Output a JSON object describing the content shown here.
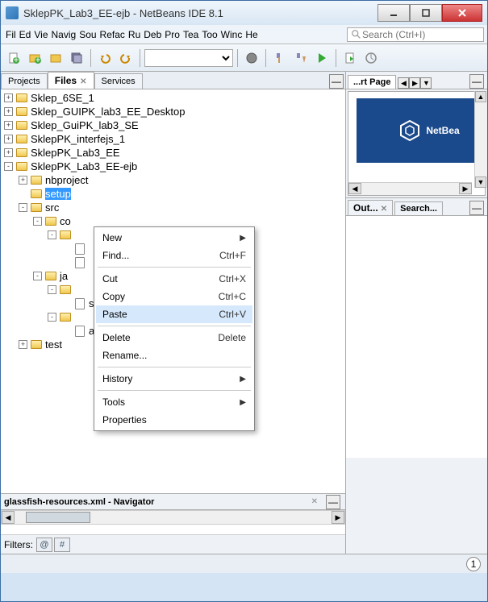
{
  "title": "SklepPK_Lab3_EE-ejb - NetBeans IDE 8.1",
  "menus": [
    "Fil",
    "Ed",
    "Vie",
    "Navig",
    "Sou",
    "Refac",
    "Ru",
    "Deb",
    "Pro",
    "Tea",
    "Too",
    "Winc",
    "He"
  ],
  "search_placeholder": "Search (Ctrl+I)",
  "tabs": {
    "projects": "Projects",
    "files": "Files",
    "services": "Services"
  },
  "tree": [
    {
      "indent": 0,
      "toggle": "+",
      "icon": "folder",
      "label": "Sklep_6SE_1"
    },
    {
      "indent": 0,
      "toggle": "+",
      "icon": "folder",
      "label": "Sklep_GUIPK_lab3_EE_Desktop"
    },
    {
      "indent": 0,
      "toggle": "+",
      "icon": "folder",
      "label": "Sklep_GuiPK_lab3_SE"
    },
    {
      "indent": 0,
      "toggle": "+",
      "icon": "folder",
      "label": "SklepPK_interfejs_1"
    },
    {
      "indent": 0,
      "toggle": "+",
      "icon": "folder",
      "label": "SklepPK_Lab3_EE"
    },
    {
      "indent": 0,
      "toggle": "-",
      "icon": "folder",
      "label": "SklepPK_Lab3_EE-ejb"
    },
    {
      "indent": 1,
      "toggle": "+",
      "icon": "folder",
      "label": "nbproject"
    },
    {
      "indent": 1,
      "toggle": "",
      "icon": "folder",
      "label": "setup",
      "selected": true
    },
    {
      "indent": 1,
      "toggle": "-",
      "icon": "folder",
      "label": "src"
    },
    {
      "indent": 2,
      "toggle": "-",
      "icon": "folder",
      "label": "co"
    },
    {
      "indent": 3,
      "toggle": "-",
      "icon": "folder",
      "label": ""
    },
    {
      "indent": 4,
      "toggle": "",
      "icon": "file",
      "label": ""
    },
    {
      "indent": 4,
      "toggle": "",
      "icon": "file",
      "label": ""
    },
    {
      "indent": 2,
      "toggle": "-",
      "icon": "folder",
      "label": "ja"
    },
    {
      "indent": 3,
      "toggle": "-",
      "icon": "folder",
      "label": ""
    },
    {
      "indent": 4,
      "toggle": "",
      "icon": "file",
      "label": "sowej_ejb.java"
    },
    {
      "indent": 3,
      "toggle": "-",
      "icon": "folder",
      "label": ""
    },
    {
      "indent": 4,
      "toggle": "",
      "icon": "file",
      "label": "ava"
    },
    {
      "indent": 1,
      "toggle": "+",
      "icon": "folder",
      "label": "test"
    }
  ],
  "context_menu": [
    {
      "label": "New",
      "shortcut": "",
      "arrow": true
    },
    {
      "label": "Find...",
      "shortcut": "Ctrl+F"
    },
    {
      "sep": true
    },
    {
      "label": "Cut",
      "shortcut": "Ctrl+X"
    },
    {
      "label": "Copy",
      "shortcut": "Ctrl+C"
    },
    {
      "label": "Paste",
      "shortcut": "Ctrl+V",
      "hover": true
    },
    {
      "sep": true
    },
    {
      "label": "Delete",
      "shortcut": "Delete"
    },
    {
      "label": "Rename..."
    },
    {
      "sep": true
    },
    {
      "label": "History",
      "arrow": true
    },
    {
      "sep": true
    },
    {
      "label": "Tools",
      "arrow": true
    },
    {
      "label": "Properties"
    }
  ],
  "navigator": {
    "title": "glassfish-resources.xml - Navigator",
    "filters_label": "Filters:"
  },
  "right_tab": "...rt Page",
  "banner_text": "NetBea",
  "output_tabs": {
    "out": "Out...",
    "search": "Search..."
  },
  "status_count": "1"
}
